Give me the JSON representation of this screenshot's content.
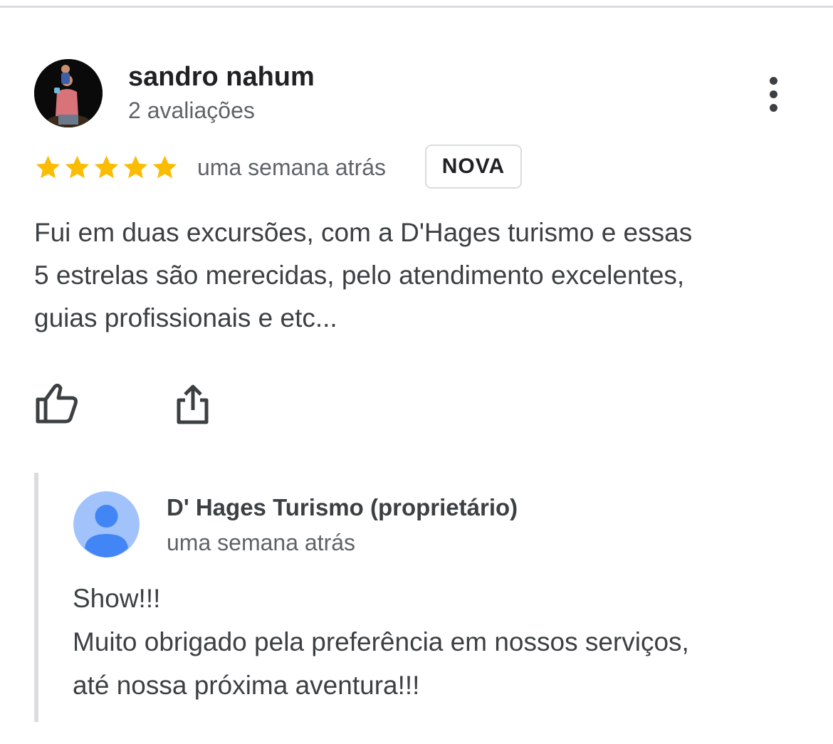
{
  "review": {
    "reviewer_name": "sandro nahum",
    "reviewer_count": "2 avaliações",
    "avatar_icon": "user-photo",
    "more_icon": "more-vert-icon",
    "rating": 5,
    "rating_max": 5,
    "star_color": "#fbbc04",
    "date": "uma semana atrás",
    "badge": "NOVA",
    "text_lines": [
      "Fui em duas excursões, com a D'Hages turismo e essas",
      "5 estrelas são merecidas, pelo atendimento excelentes,",
      "guias profissionais e etc..."
    ],
    "actions": {
      "like_icon": "thumb-up-icon",
      "share_icon": "share-icon"
    }
  },
  "owner_reply": {
    "name": "D' Hages Turismo (proprietário)",
    "date": "uma semana atrás",
    "avatar_icon": "default-person-icon",
    "avatar_bg_color": "#a1c2fa",
    "avatar_fg_color": "#4285f4",
    "text_lines": [
      "Show!!!",
      "Muito obrigado pela preferência em nossos serviços,",
      "até nossa próxima aventura!!!"
    ]
  }
}
